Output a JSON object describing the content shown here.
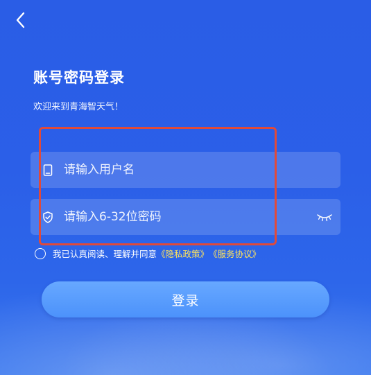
{
  "header": {
    "title": "账号密码登录",
    "subtitle": "欢迎来到青海智天气！"
  },
  "form": {
    "username_placeholder": "请输入用户名",
    "password_placeholder": "请输入6-32位密码"
  },
  "agreement": {
    "text": "我已认真阅读、理解并同意",
    "privacy_link": "《隐私政策》",
    "service_link": "《服务协议》"
  },
  "actions": {
    "login_label": "登录"
  },
  "colors": {
    "background": "#2b5fe8",
    "link": "#ffe35c",
    "highlight_border": "#e04a3a",
    "button": "#5a9cff"
  },
  "icons": {
    "back": "chevron-left-icon",
    "username": "phone-icon",
    "password": "shield-check-icon",
    "password_toggle": "eye-closed-icon"
  }
}
